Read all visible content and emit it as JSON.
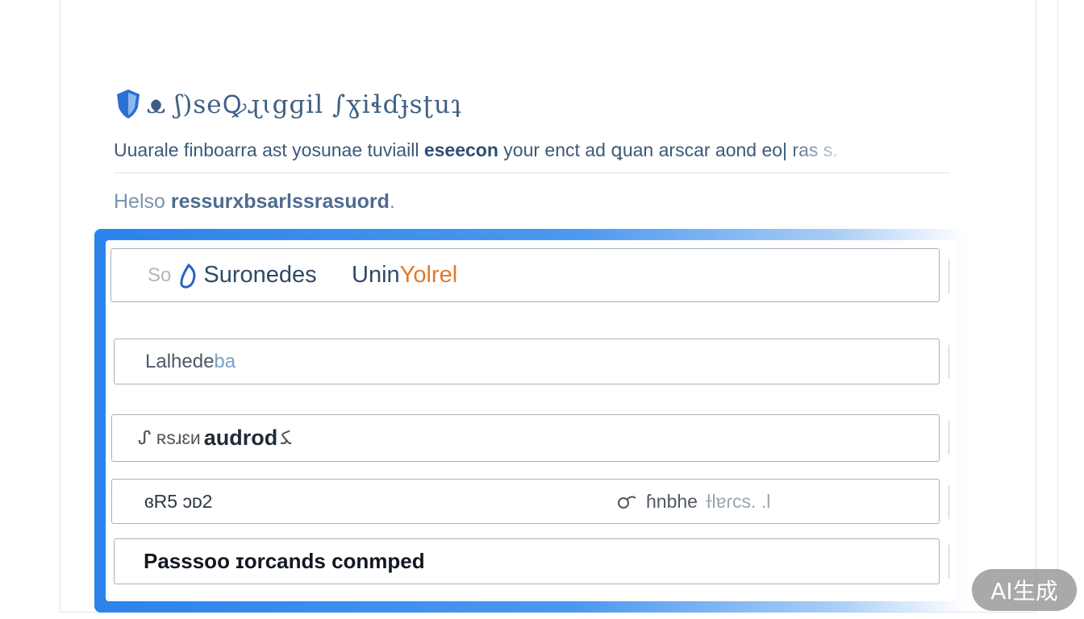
{
  "header": {
    "title": "ᴥ ʃ)seꝘɻɩgɡil ∫ɣiɬɗɟsʈuʇ",
    "subtitle_main": "Uuarale finboarra ast yosunae tuviaill ",
    "subtitle_bold": "eseecon",
    "subtitle_rest": " your enct ad ꝗuan arscar aond eo|",
    "subtitle_fade": " ras s.",
    "hint_prefix": "Helso ",
    "hint_bold": "ressurxbsarlssrasuord",
    "hint_suffix": "."
  },
  "form": {
    "field1": {
      "prefix": "So",
      "option_a": "Suronedes",
      "option_b": "Unin",
      "option_b_accent": "Yolrel"
    },
    "field2": {
      "value": "Lalhede",
      "value_lite": "ba"
    },
    "field3": {
      "lead": "ᔑ ʀsɹɛᴎ",
      "value": "audrod",
      "trail": "ﻜ"
    },
    "field4": {
      "left": "ɞR5 ᴐᴅ2",
      "right": "ɦnbhe",
      "right_lite": "ɫlɐɾcs. .l"
    },
    "field5": {
      "value": "Passsoo ɪorcands conmped"
    }
  },
  "watermark": {
    "text": "AI生成"
  },
  "colors": {
    "accent": "#2c83ec",
    "title": "#3e5f83",
    "highlight": "#e07a2c"
  },
  "icons": [
    "shield-icon",
    "drop-icon",
    "key-icon",
    "link-icon"
  ]
}
